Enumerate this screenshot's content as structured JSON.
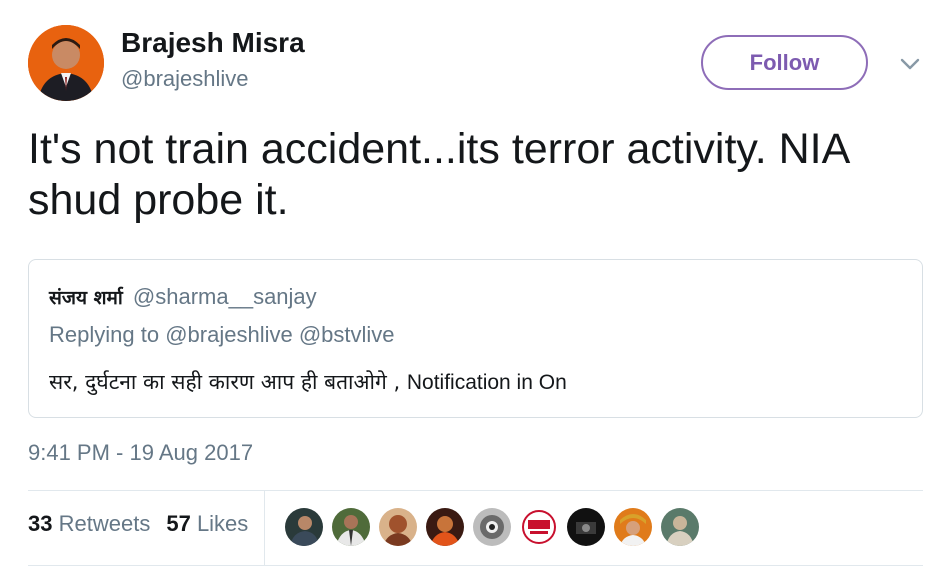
{
  "author": {
    "name": "Brajesh Misra",
    "handle": "@brajeshlive"
  },
  "follow_label": "Follow",
  "tweet_text": "It's not train accident...its terror activity. NIA shud probe it.",
  "quoted_tweet": {
    "name": "संजय शर्मा",
    "handle": "@sharma__sanjay",
    "replying_prefix": "Replying to",
    "replying_to": [
      "@brajeshlive",
      "@bstvlive"
    ],
    "text_hindi": "सर, दुर्घटना का सही कारण आप ही बताओगे ,",
    "text_latin": "Notification in On"
  },
  "timestamp": "9:41 PM - 19 Aug 2017",
  "stats": {
    "retweets_count": "33",
    "retweets_label": "Retweets",
    "likes_count": "57",
    "likes_label": "Likes"
  },
  "likers": [
    {
      "icon": "liker-avatar-1",
      "color": "#2a3a3a"
    },
    {
      "icon": "liker-avatar-2",
      "color": "#4f6b3a"
    },
    {
      "icon": "liker-avatar-3",
      "color": "#a0522d"
    },
    {
      "icon": "liker-avatar-4",
      "color": "#6b2a1a"
    },
    {
      "icon": "liker-avatar-5",
      "color": "#9a9a9a"
    },
    {
      "icon": "liker-avatar-6",
      "color": "#c8102e"
    },
    {
      "icon": "liker-avatar-7",
      "color": "#111111"
    },
    {
      "icon": "liker-avatar-8",
      "color": "#e07b1a"
    },
    {
      "icon": "liker-avatar-9",
      "color": "#5a7a6a"
    }
  ],
  "colors": {
    "follow_accent": "#7d5bb0",
    "secondary_text": "#657786",
    "divider": "#e1e8ed"
  }
}
